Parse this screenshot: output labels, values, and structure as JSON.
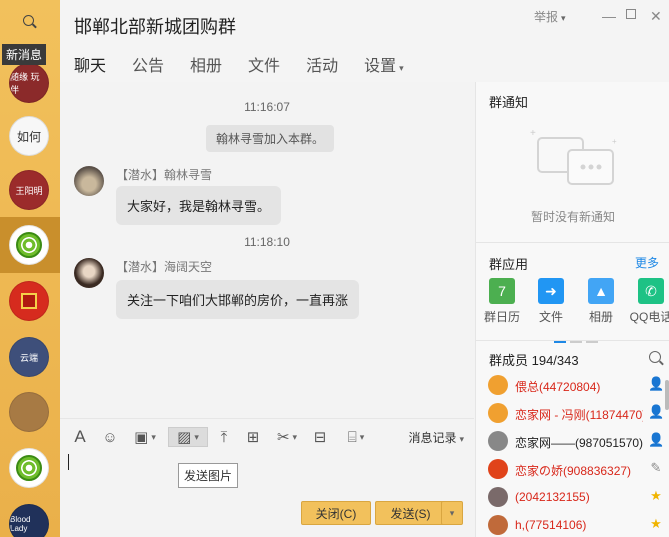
{
  "sidebar": {
    "tooltip": "新消息",
    "avatars": [
      {
        "label": "随缘 玩伴",
        "bg": "#8b2a2a"
      },
      {
        "label": "如何",
        "bg": "#f7f7f7"
      },
      {
        "label": "王阳明",
        "bg": "#9b2b2b"
      },
      {
        "label": "",
        "bg": "snail"
      },
      {
        "label": "",
        "bg": "#d62b1e"
      },
      {
        "label": "云端",
        "bg": "#3e4f7a"
      },
      {
        "label": "",
        "bg": "#a77a44"
      },
      {
        "label": "",
        "bg": "snail"
      },
      {
        "label": "Blood Lady",
        "bg": "#20315a"
      }
    ]
  },
  "header": {
    "title": "邯郸北部新城团购群",
    "report": "举报",
    "tabs": [
      "聊天",
      "公告",
      "相册",
      "文件",
      "活动",
      "设置"
    ]
  },
  "chat": {
    "time1": "11:16:07",
    "system_msg": "翰林寻雪加入本群。",
    "msg1": {
      "name": "【潜水】翰林寻雪",
      "text": "大家好，我是翰林寻雪。"
    },
    "time2": "11:18:10",
    "msg2": {
      "name": "【潜水】海阔天空",
      "text": "关注一下咱们大邯郸的房价，一直再涨"
    }
  },
  "toolbar": {
    "record_label": "消息记录",
    "tooltip": "发送图片"
  },
  "input": {
    "close_label": "关闭(C)",
    "send_label": "发送(S)"
  },
  "right": {
    "notice_title": "群通知",
    "notice_empty": "暂时没有新通知",
    "apps_title": "群应用",
    "more": "更多",
    "apps": [
      {
        "label": "群日历",
        "color": "#4caf50",
        "icon": "calendar-icon",
        "glyph": "7"
      },
      {
        "label": "文件",
        "color": "#2196f3",
        "icon": "upload-icon",
        "glyph": "➜"
      },
      {
        "label": "相册",
        "color": "#42a5f5",
        "icon": "picture-icon",
        "glyph": "▲"
      },
      {
        "label": "QQ电话",
        "color": "#1ec285",
        "icon": "phone-icon",
        "glyph": "✆"
      }
    ],
    "members_title": "群成员 194/343",
    "members": [
      {
        "name": "偎总(44720804)",
        "color": "#d8271a",
        "badge": "👤",
        "avatar": "#f0a030"
      },
      {
        "name": "恋家网 - 冯刚(11874470)",
        "color": "#d8271a",
        "badge": "👤",
        "avatar": "#f0a030"
      },
      {
        "name": "恋家网——(987051570)",
        "color": "#222",
        "badge": "👤",
        "avatar": "#888"
      },
      {
        "name": "恋家の娇(908836327)",
        "color": "#d8271a",
        "badge": "✎",
        "avatar": "#e0431a"
      },
      {
        "name": "(2042132155)",
        "color": "#d8271a",
        "badge": "★",
        "avatar": "#7a6a6a"
      },
      {
        "name": "h,(77514106)",
        "color": "#d8271a",
        "badge": "★",
        "avatar": "#c06a3a"
      }
    ]
  }
}
